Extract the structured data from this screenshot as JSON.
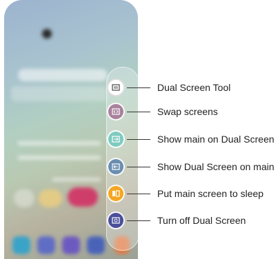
{
  "callouts": [
    {
      "label": "Dual Screen Tool",
      "color": "#ffffff",
      "icon": "dual-screen-tool-icon"
    },
    {
      "label": "Swap screens",
      "color": "#a9829d",
      "icon": "swap-screens-icon"
    },
    {
      "label": "Show main on Dual Screen",
      "color": "#7fcbc0",
      "icon": "show-main-on-dual-icon"
    },
    {
      "label": "Show Dual Screen on main",
      "color": "#6b8eb0",
      "icon": "show-dual-on-main-icon"
    },
    {
      "label": "Put main screen to sleep",
      "color": "#f5a623",
      "icon": "sleep-main-icon"
    },
    {
      "label": "Turn off Dual Screen",
      "color": "#4a4f9a",
      "icon": "turn-off-dual-icon"
    }
  ]
}
